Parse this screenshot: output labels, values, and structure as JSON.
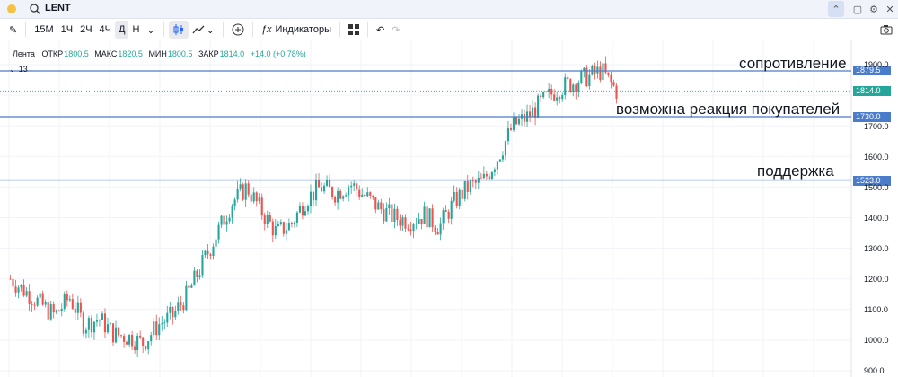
{
  "titlebar": {
    "symbol": "LENT",
    "icons": [
      "search-icon",
      "chevron-up-icon",
      "window-icon",
      "gear-icon",
      "close-icon"
    ]
  },
  "toolbar": {
    "intervals": [
      "15М",
      "1Ч",
      "2Ч",
      "4Ч",
      "Д",
      "Н"
    ],
    "active_interval": "Д",
    "indicators_label": "Индикаторы"
  },
  "legend": {
    "name": "Лента",
    "open_label": "ОТКР",
    "open": "1800.5",
    "high_label": "МАКС",
    "high": "1820.5",
    "low_label": "МИН",
    "low": "1800.5",
    "close_label": "ЗАКР",
    "close": "1814.0",
    "change": "+14.0 (+0.78%)",
    "indicator_count": "13"
  },
  "levels": [
    {
      "name": "resistance",
      "price": "1879.5",
      "text": "сопротивление",
      "color": "#4a7cc9"
    },
    {
      "name": "buyers",
      "price": "1730.0",
      "text": "возможна реакция покупателей",
      "color": "#4a7cc9"
    },
    {
      "name": "support",
      "price": "1523.0",
      "text": "поддержка",
      "color": "#4a7cc9"
    }
  ],
  "current_price": {
    "value": "1814.0",
    "color": "#26a69a"
  },
  "price_axis": [
    "1900.0",
    "1700.0",
    "1600.0",
    "1500.0",
    "1400.0",
    "1300.0",
    "1200.0",
    "1100.0",
    "1000.0",
    "900.0"
  ],
  "colors": {
    "up": "#26a69a",
    "down": "#ef5350",
    "line": "#4a7cc9"
  },
  "chart_data": {
    "type": "candlestick",
    "approx_close_path": [
      1200,
      1160,
      1120,
      1080,
      1140,
      1050,
      1070,
      1020,
      1010,
      990,
      1050,
      1080,
      1150,
      1250,
      1350,
      1450,
      1500,
      1420,
      1350,
      1380,
      1460,
      1500,
      1480,
      1510,
      1470,
      1430,
      1400,
      1390,
      1410,
      1370,
      1450,
      1500,
      1520,
      1600,
      1700,
      1730,
      1780,
      1820,
      1840,
      1860,
      1880,
      1814
    ],
    "ylim": [
      900,
      1920
    ]
  }
}
